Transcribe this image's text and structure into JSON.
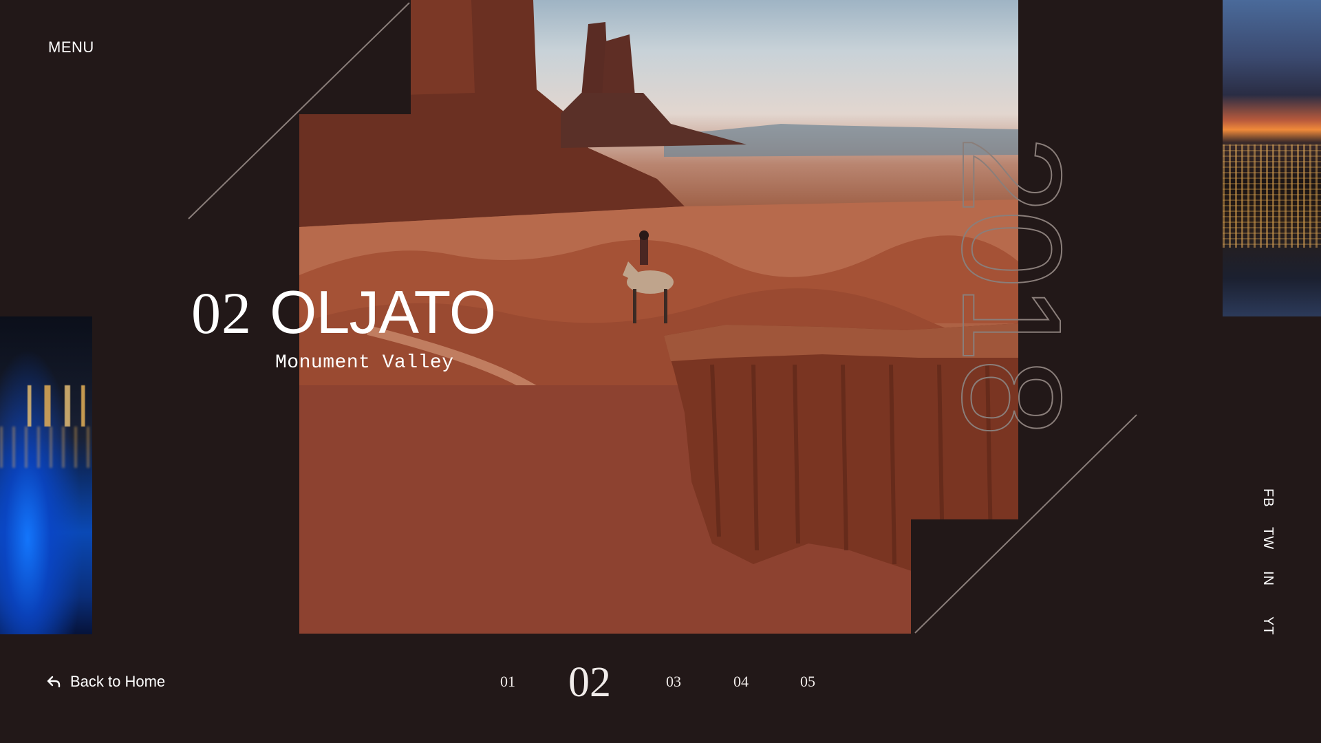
{
  "nav": {
    "menu_label": "MENU"
  },
  "hero": {
    "number": "02",
    "title": "OLJATO",
    "subtitle": "Monument Valley",
    "year": "2018"
  },
  "footer": {
    "back_label": "Back to Home",
    "pages": [
      "01",
      "02",
      "03",
      "04",
      "05"
    ],
    "active_page": "02"
  },
  "social": [
    "FB",
    "TW",
    "IN",
    "YT"
  ],
  "colors": {
    "background": "#221818",
    "text": "#ffffff",
    "line": "#8a7e7a"
  }
}
